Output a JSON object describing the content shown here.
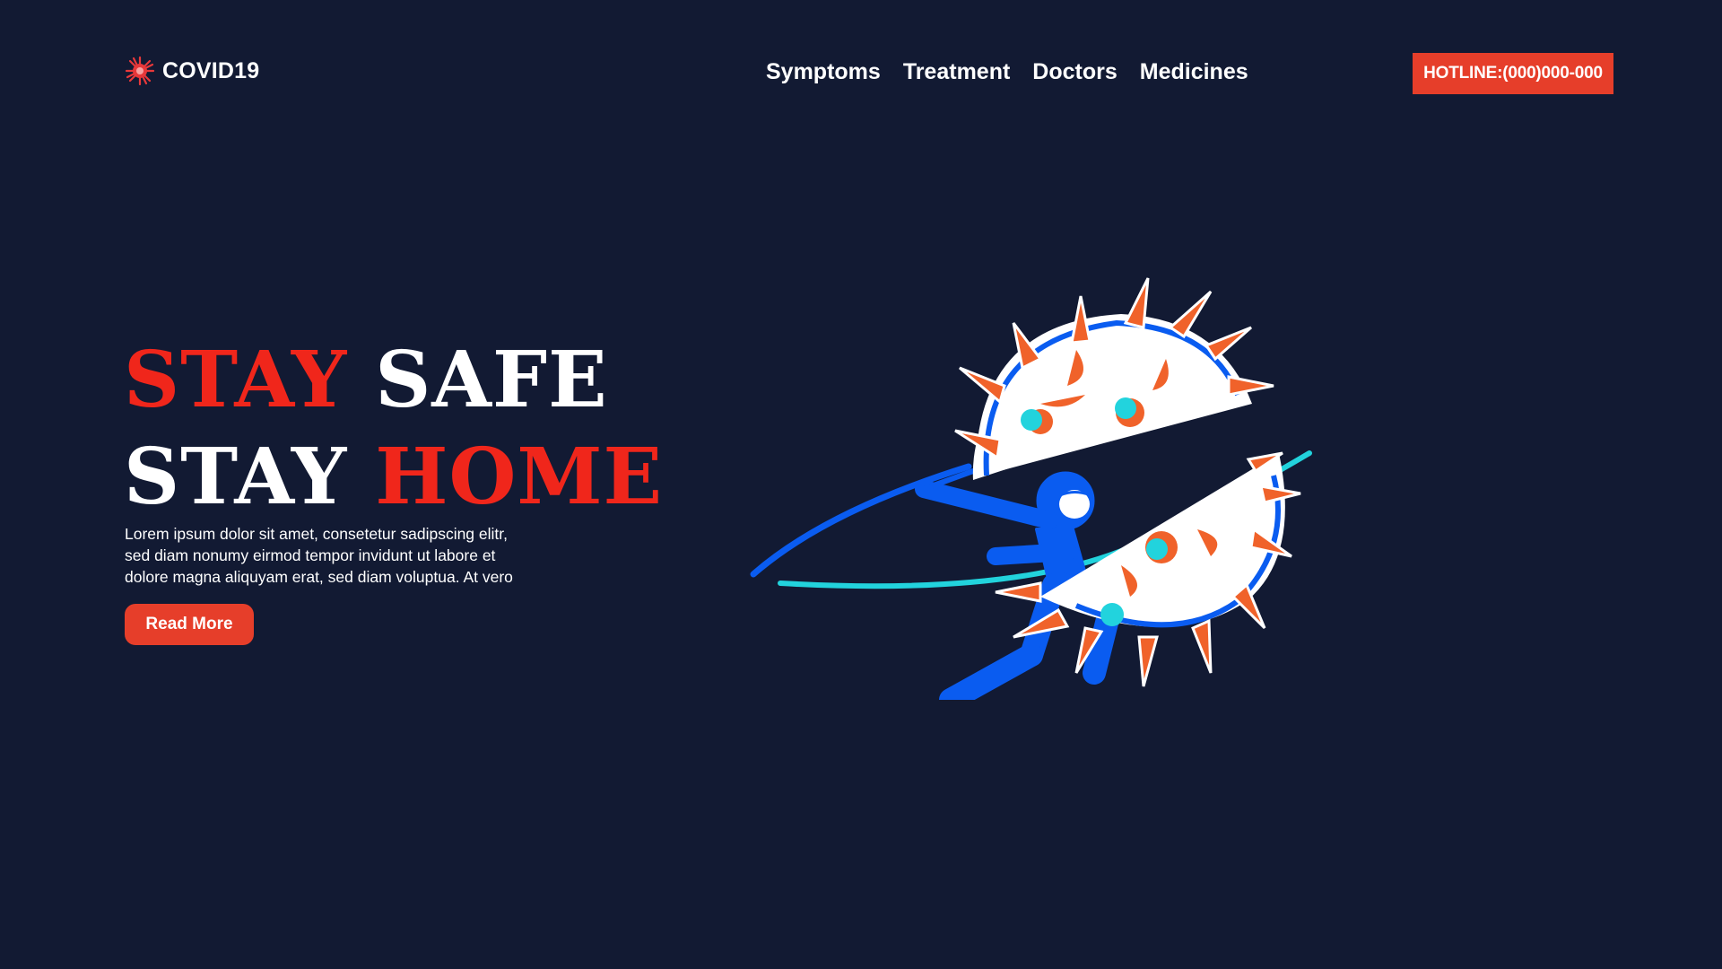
{
  "header": {
    "logo_text": "COVID19",
    "logo_icon": "virus-icon",
    "nav": [
      {
        "label": "Symptoms"
      },
      {
        "label": "Treatment"
      },
      {
        "label": "Doctors"
      },
      {
        "label": "Medicines"
      }
    ],
    "hotline_label": "HOTLINE:(000)000-000"
  },
  "hero": {
    "line1_word1": "STAY",
    "line1_word2": "SAFE",
    "line2_word1": "STAY",
    "line2_word2": "HOME",
    "lede": "Lorem ipsum dolor sit amet, consetetur sadipscing elitr, sed diam nonumy eirmod tempor invidunt ut labore et dolore magna aliquyam erat, sed diam voluptua. At vero",
    "cta_label": "Read More"
  },
  "illustration": {
    "icon": "ninja-slicing-virus-illustration"
  },
  "colors": {
    "background": "#121a33",
    "accent_red": "#e63e2a",
    "headline_red": "#f0261b",
    "ninja_blue": "#0a5cf0",
    "virus_orange": "#f0622a",
    "virus_cyan": "#22d3dd"
  }
}
